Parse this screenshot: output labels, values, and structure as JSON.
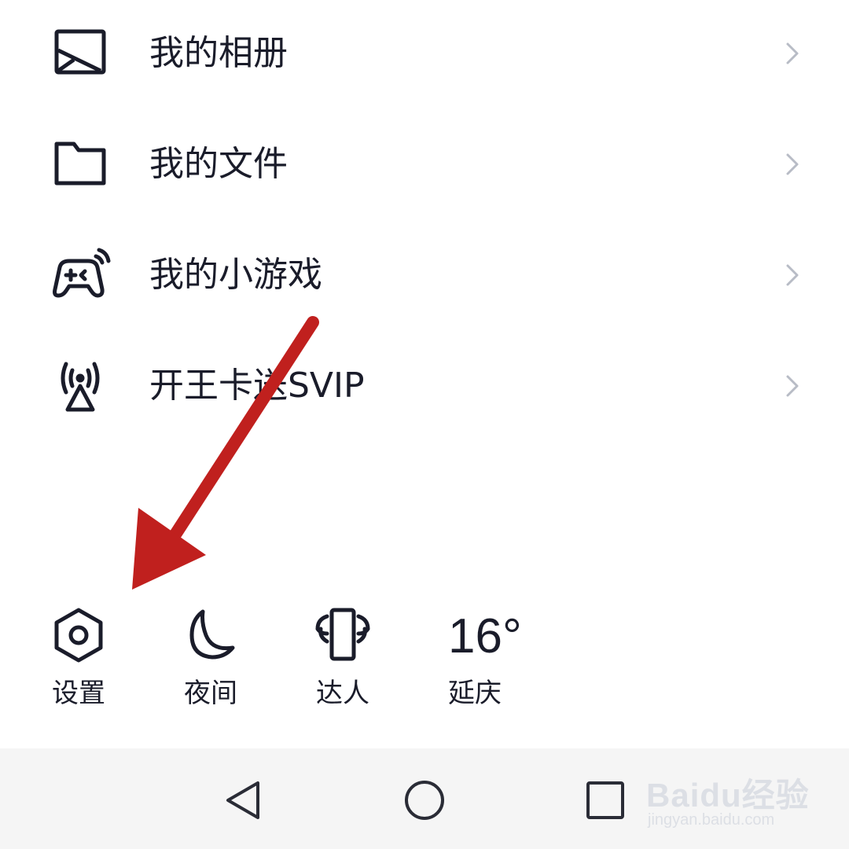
{
  "menu": {
    "items": [
      {
        "label": "我的相册",
        "icon": "photo-album-icon"
      },
      {
        "label": "我的文件",
        "icon": "folder-icon"
      },
      {
        "label": "我的小游戏",
        "icon": "gamepad-icon"
      },
      {
        "label": "开王卡送SVIP",
        "icon": "signal-tower-icon"
      }
    ]
  },
  "quick_actions": {
    "settings": {
      "label": "设置",
      "icon": "settings-hexagon-icon"
    },
    "night": {
      "label": "夜间",
      "icon": "moon-icon"
    },
    "talent": {
      "label": "达人",
      "icon": "winged-phone-icon"
    },
    "weather": {
      "temperature": "16°",
      "location": "延庆"
    }
  },
  "navbar": {
    "back": "back-triangle-icon",
    "home": "home-circle-icon",
    "recents": "recents-square-icon"
  },
  "watermark": {
    "logo": "Baidu经验",
    "url": "jingyan.baidu.com"
  },
  "colors": {
    "text": "#1a1c2a",
    "chevron": "#b8bcc6",
    "annotation_arrow": "#c0201e",
    "navbar_bg": "#f5f5f5"
  }
}
